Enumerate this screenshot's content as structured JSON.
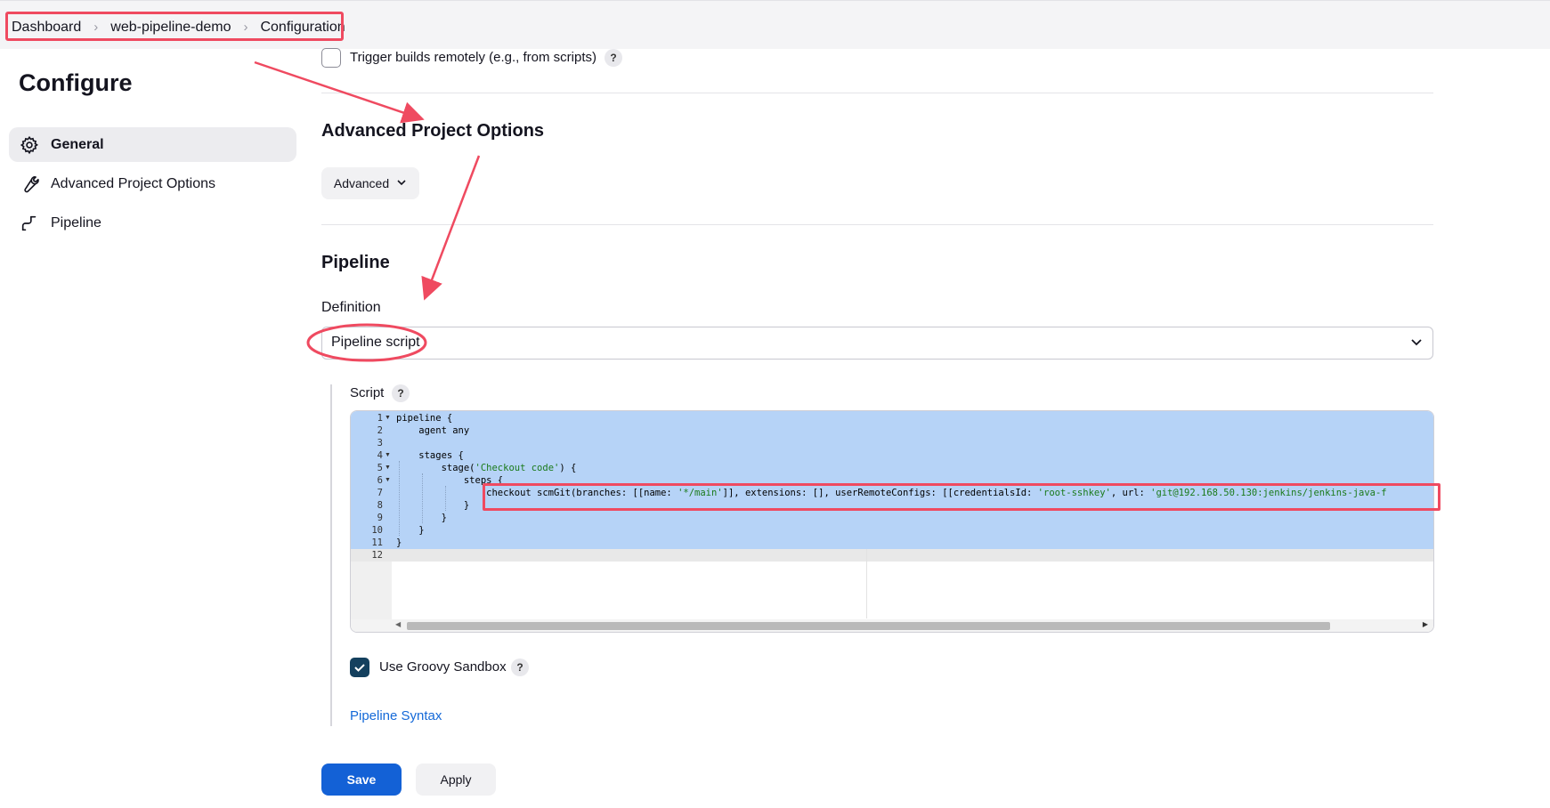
{
  "breadcrumb": [
    "Dashboard",
    "web-pipeline-demo",
    "Configuration"
  ],
  "sidebar": {
    "title": "Configure",
    "items": [
      {
        "label": "General",
        "icon": "gear-icon",
        "active": true
      },
      {
        "label": "Advanced Project Options",
        "icon": "wrench-icon",
        "active": false
      },
      {
        "label": "Pipeline",
        "icon": "pipeline-icon",
        "active": false
      }
    ]
  },
  "trigger": {
    "label": "Trigger builds remotely (e.g., from scripts)",
    "help": "?"
  },
  "advanced_section": {
    "title": "Advanced Project Options",
    "button_label": "Advanced"
  },
  "pipeline_section": {
    "title": "Pipeline",
    "definition_label": "Definition",
    "definition_value": "Pipeline script",
    "script_label": "Script",
    "script_help": "?",
    "line_numbers": [
      "1",
      "2",
      "3",
      "4",
      "5",
      "6",
      "7",
      "8",
      "9",
      "10",
      "11",
      "12"
    ],
    "code_lines": [
      "pipeline {",
      "    agent any",
      "",
      "    stages {",
      "        stage('Checkout code') {",
      "            steps {",
      "                checkout scmGit(branches: [[name: '*/main']], extensions: [], userRemoteConfigs: [[credentialsId: 'root-sshkey', url: 'git@192.168.50.130:jenkins/jenkins-java-f",
      "            }",
      "        }",
      "    }",
      "}",
      ""
    ],
    "sandbox_label": "Use Groovy Sandbox",
    "sandbox_checked": true,
    "sandbox_help": "?",
    "syntax_link": "Pipeline Syntax"
  },
  "buttons": {
    "save": "Save",
    "apply": "Apply"
  },
  "colors": {
    "accent": "#1361d6",
    "annotation": "#ef4a60",
    "selection": "#b6d3f7",
    "string": "#1a7a1a"
  }
}
